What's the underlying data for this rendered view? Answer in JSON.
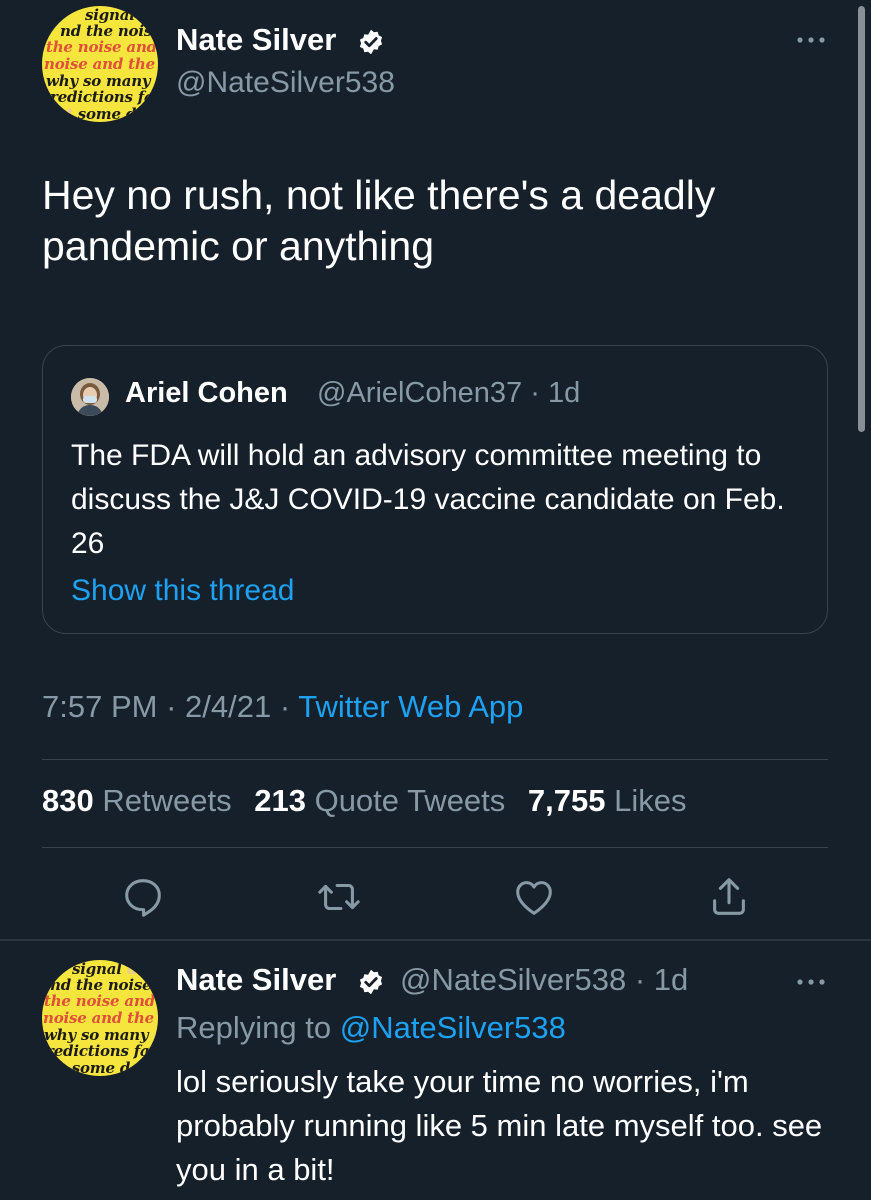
{
  "main_tweet": {
    "author_name": "Nate Silver",
    "author_handle": "@NateSilver538",
    "text": "Hey no rush, not like there's a deadly pandemic or anything",
    "avatar_lines": [
      "signal and",
      "nd the noise a",
      "the noise and th",
      "noise and the no",
      "why so many and",
      "redictions fail",
      "t some don"
    ],
    "quoted": {
      "author_name": "Ariel Cohen",
      "author_handle": "@ArielCohen37",
      "separator": "·",
      "time_ago": "1d",
      "text": "The FDA will hold an advisory committee meeting to discuss the J&J COVID-19 vaccine candidate on Feb. 26",
      "show_thread": "Show this thread"
    },
    "time": "7:57 PM",
    "separator": "·",
    "date": "2/4/21",
    "app": "Twitter Web App",
    "stats": {
      "retweets_count": "830",
      "retweets_label": "Retweets",
      "quotes_count": "213",
      "quotes_label": "Quote Tweets",
      "likes_count": "7,755",
      "likes_label": "Likes"
    },
    "actions": [
      "reply-icon",
      "retweet-icon",
      "like-icon",
      "share-icon"
    ]
  },
  "reply_tweet": {
    "author_name": "Nate Silver",
    "author_handle": "@NateSilver538",
    "separator": "·",
    "time_ago": "1d",
    "replying_prefix": "Replying to",
    "replying_to": "@NateSilver538",
    "text": "lol seriously take your time no worries, i'm probably running like 5 min late myself too. see you in a bit!"
  },
  "colors": {
    "background": "#15202b",
    "text_primary": "#ffffff",
    "text_secondary": "#8899a6",
    "link": "#1da1f2",
    "border": "#38444d",
    "avatar_yellow": "#f6e53c"
  }
}
